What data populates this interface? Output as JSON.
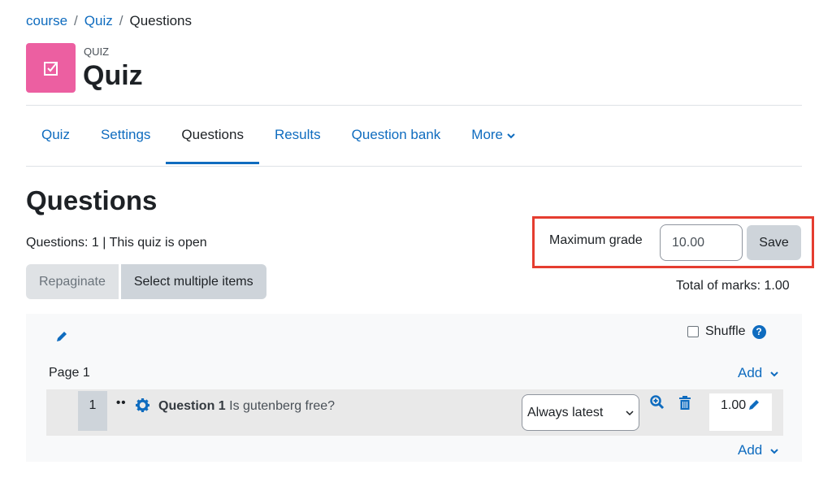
{
  "breadcrumb": [
    {
      "label": "course",
      "link": true
    },
    {
      "label": "Quiz",
      "link": true
    },
    {
      "label": "Questions",
      "link": false
    }
  ],
  "breadcrumb_separator": "/",
  "header": {
    "eyebrow": "QUIZ",
    "title": "Quiz",
    "icon": "quiz-checkbox-icon",
    "icon_color": "#ec5fa1"
  },
  "tabs": [
    {
      "label": "Quiz",
      "active": false
    },
    {
      "label": "Settings",
      "active": false
    },
    {
      "label": "Questions",
      "active": true
    },
    {
      "label": "Results",
      "active": false
    },
    {
      "label": "Question bank",
      "active": false
    },
    {
      "label": "More",
      "active": false,
      "dropdown": true
    }
  ],
  "page": {
    "heading": "Questions",
    "meta": "Questions: 1 | This quiz is open",
    "repaginate_label": "Repaginate",
    "select_multiple_label": "Select multiple items"
  },
  "grade": {
    "label": "Maximum grade",
    "value": "10.00",
    "save_label": "Save",
    "total_marks": "Total of marks: 1.00",
    "highlight_color": "#e53d30"
  },
  "section": {
    "shuffle_label": "Shuffle",
    "shuffle_checked": false,
    "page_label": "Page 1",
    "add_label": "Add",
    "questions": [
      {
        "number": "1",
        "title": "Question 1",
        "text": "Is gutenberg free?",
        "version": "Always latest",
        "mark": "1.00"
      }
    ]
  },
  "colors": {
    "accent": "#0f6cbf"
  }
}
